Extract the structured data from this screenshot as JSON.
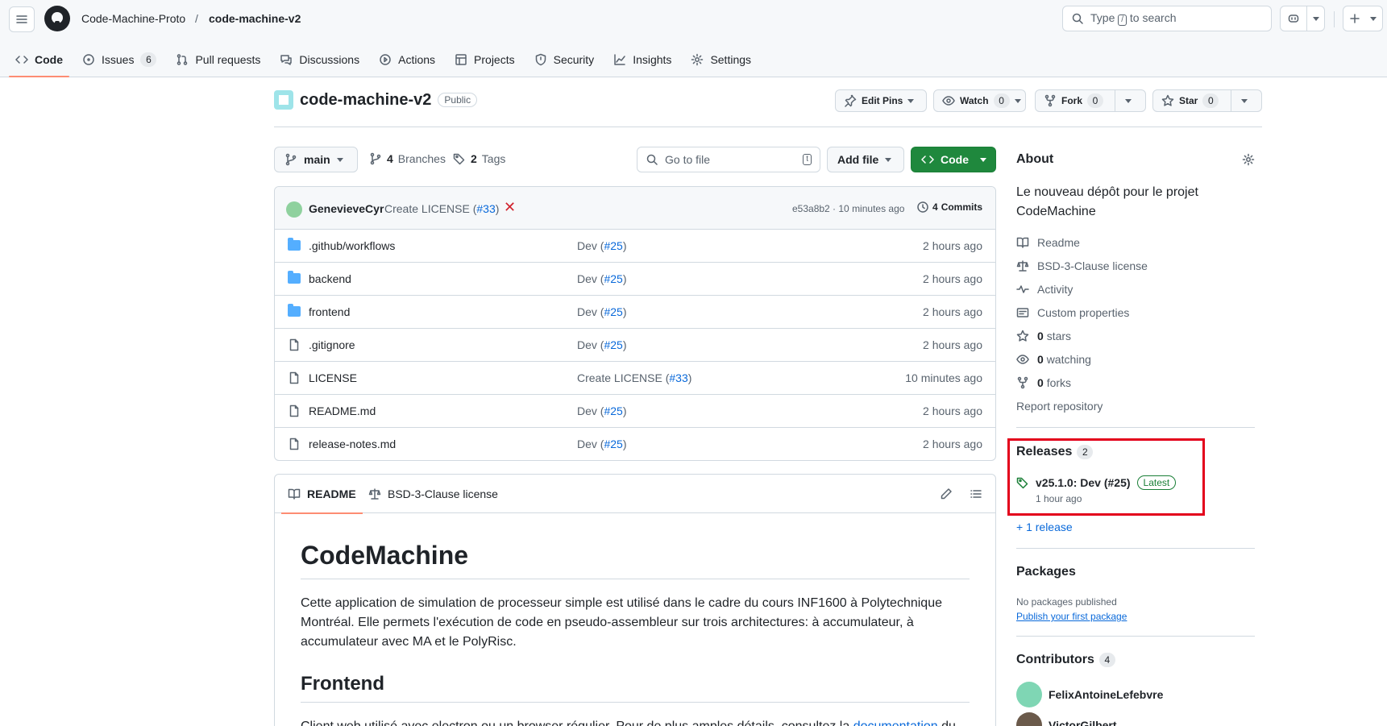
{
  "header": {
    "org": "Code-Machine-Proto",
    "separator": "/",
    "repo": "code-machine-v2",
    "search_prefix": "Type",
    "search_key": "/",
    "search_suffix": "to search"
  },
  "nav_tabs": [
    {
      "label": "Code",
      "icon": "code-icon"
    },
    {
      "label": "Issues",
      "icon": "issue-icon",
      "count": "6"
    },
    {
      "label": "Pull requests",
      "icon": "pull-request-icon"
    },
    {
      "label": "Discussions",
      "icon": "discussion-icon"
    },
    {
      "label": "Actions",
      "icon": "play-icon"
    },
    {
      "label": "Projects",
      "icon": "table-icon"
    },
    {
      "label": "Security",
      "icon": "shield-icon"
    },
    {
      "label": "Insights",
      "icon": "graph-icon"
    },
    {
      "label": "Settings",
      "icon": "gear-icon"
    }
  ],
  "repo_header": {
    "name": "code-machine-v2",
    "visibility": "Public",
    "edit_pins": "Edit Pins",
    "watch": "Watch",
    "watch_count": "0",
    "fork": "Fork",
    "fork_count": "0",
    "star": "Star",
    "star_count": "0"
  },
  "toolbar": {
    "branch": "main",
    "branches_count": "4",
    "branches_label": "Branches",
    "tags_count": "2",
    "tags_label": "Tags",
    "goto_placeholder": "Go to file",
    "goto_key": "t",
    "add_file": "Add file",
    "code": "Code"
  },
  "latest_commit": {
    "author": "GenevieveCyr",
    "message": "Create LICENSE (",
    "ref": "#33",
    "message_end": ")",
    "sha_time": "e53a8b2 · 10 minutes ago",
    "commits_count": "4",
    "commits_label": "Commits"
  },
  "files": [
    {
      "name": ".github/workflows",
      "type": "folder",
      "msg": "Dev (",
      "ref": "#25",
      "msg_end": ")",
      "time": "2 hours ago"
    },
    {
      "name": "backend",
      "type": "folder",
      "msg": "Dev (",
      "ref": "#25",
      "msg_end": ")",
      "time": "2 hours ago"
    },
    {
      "name": "frontend",
      "type": "folder",
      "msg": "Dev (",
      "ref": "#25",
      "msg_end": ")",
      "time": "2 hours ago"
    },
    {
      "name": ".gitignore",
      "type": "file",
      "msg": "Dev (",
      "ref": "#25",
      "msg_end": ")",
      "time": "2 hours ago"
    },
    {
      "name": "LICENSE",
      "type": "file",
      "msg": "Create LICENSE (",
      "ref": "#33",
      "msg_end": ")",
      "time": "10 minutes ago"
    },
    {
      "name": "README.md",
      "type": "file",
      "msg": "Dev (",
      "ref": "#25",
      "msg_end": ")",
      "time": "2 hours ago"
    },
    {
      "name": "release-notes.md",
      "type": "file",
      "msg": "Dev (",
      "ref": "#25",
      "msg_end": ")",
      "time": "2 hours ago"
    }
  ],
  "readme": {
    "tab_readme": "README",
    "tab_license": "BSD-3-Clause license",
    "title": "CodeMachine",
    "para1": "Cette application de simulation de processeur simple est utilisé dans le cadre du cours INF1600 à Polytechnique Montréal. Elle permets l'exécution de code en pseudo-assembleur sur trois architectures: à accumulateur, à accumulateur avec MA et le PolyRisc.",
    "h2": "Frontend",
    "para2_start": "Client web utilisé avec electron ou un browser régulier. Pour de plus amples détails, consultez la ",
    "para2_link": "documentation",
    "para2_end": " du"
  },
  "about": {
    "title": "About",
    "description": "Le nouveau dépôt pour le projet CodeMachine",
    "items": [
      {
        "label": "Readme",
        "icon": "book-icon"
      },
      {
        "label": "BSD-3-Clause license",
        "icon": "law-icon"
      },
      {
        "label": "Activity",
        "icon": "pulse-icon"
      },
      {
        "label": "Custom properties",
        "icon": "note-icon"
      },
      {
        "bold": "0",
        "label": "stars",
        "icon": "star-icon"
      },
      {
        "bold": "0",
        "label": "watching",
        "icon": "eye-icon"
      },
      {
        "bold": "0",
        "label": "forks",
        "icon": "fork-icon"
      }
    ],
    "report": "Report repository"
  },
  "releases": {
    "title": "Releases",
    "count": "2",
    "latest_name": "v25.1.0: Dev (#25)",
    "latest_badge": "Latest",
    "latest_time": "1 hour ago",
    "more": "+ 1 release"
  },
  "packages": {
    "title": "Packages",
    "none": "No packages published",
    "publish": "Publish your first package"
  },
  "contributors": {
    "title": "Contributors",
    "count": "4",
    "list": [
      "FelixAntoineLefebvre",
      "VictorGilbert"
    ]
  },
  "colors": {
    "accent_tab": "#fd8c73",
    "green_button": "#1f883d",
    "link": "#0969da",
    "highlight_box": "#e3001b"
  }
}
